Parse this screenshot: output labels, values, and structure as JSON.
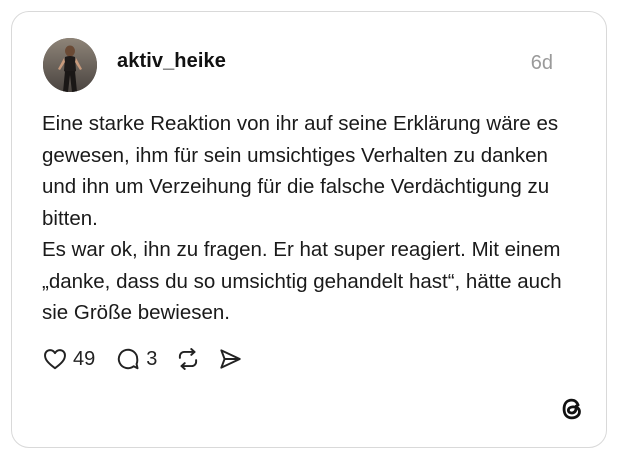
{
  "post": {
    "username": "aktiv_heike",
    "timestamp": "6d",
    "paragraphs": [
      "Eine starke Reaktion von ihr auf seine Erklärung wäre es gewesen, ihm für sein umsichtiges Verhalten zu danken und ihn um Verzeihung für die falsche Verdächtigung zu bitten.",
      "Es war ok, ihn zu fragen. Er hat super reagiert. Mit einem „danke, dass du so umsichtig gehandelt hast“, hätte auch sie Größe bewiesen."
    ]
  },
  "actions": {
    "likes": "49",
    "replies": "3"
  },
  "icons": {
    "like": "heart-icon",
    "reply": "comment-icon",
    "repost": "repost-icon",
    "share": "send-icon",
    "brand": "threads-logo-icon"
  },
  "colors": {
    "text": "#1a1a1a",
    "muted": "#9a9a9a",
    "border": "#d9d9d9"
  }
}
